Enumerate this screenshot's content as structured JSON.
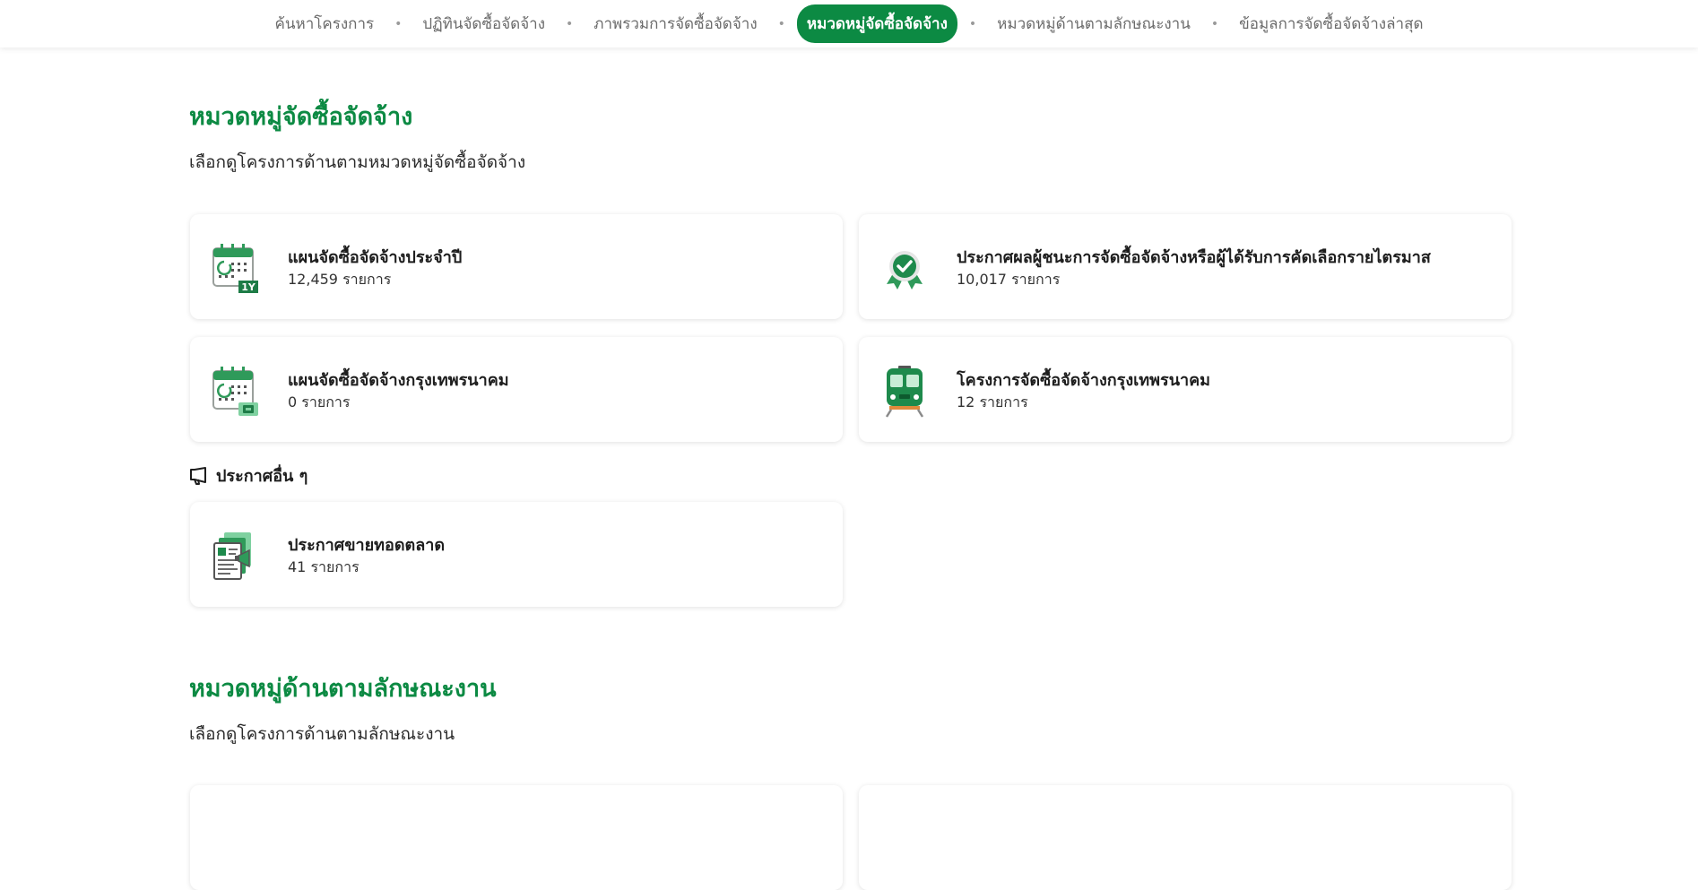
{
  "nav": {
    "items": [
      {
        "label": "ค้นหาโครงการ"
      },
      {
        "label": "ปฏิทินจัดซื้อจัดจ้าง"
      },
      {
        "label": "ภาพรวมการจัดซื้อจัดจ้าง"
      },
      {
        "label": "หมวดหมู่จัดซื้อจัดจ้าง",
        "active": true
      },
      {
        "label": "หมวดหมู่ด้านตามลักษณะงาน"
      },
      {
        "label": "ข้อมูลการจัดซื้อจัดจ้างล่าสุด"
      }
    ]
  },
  "procurement": {
    "title": "หมวดหมู่จัดซื้อจัดจ้าง",
    "description": "เลือกดูโครงการด้านตามหมวดหมู่จัดซื้อจัดจ้าง",
    "cards": [
      {
        "title": "แผนจัดซื้อจัดจ้างประจำปี",
        "count": "12,459 รายการ",
        "icon": "calendar-1y-icon",
        "badge": "1Y"
      },
      {
        "title": "ประกาศผลผู้ชนะการจัดซื้อจัดจ้างหรือผู้ได้รับการคัดเลือกรายไตรมาส",
        "count": "10,017 รายการ",
        "icon": "award-check-icon"
      },
      {
        "title": "แผนจัดซื้อจัดจ้างกรุงเทพรนาคม",
        "count": "0 รายการ",
        "icon": "calendar-bkt-icon"
      },
      {
        "title": "โครงการจัดซื้อจัดจ้างกรุงเทพรนาคม",
        "count": "12 รายการ",
        "icon": "train-icon"
      }
    ]
  },
  "other": {
    "heading": "ประกาศอื่น ๆ",
    "cards": [
      {
        "title": "ประกาศขายทอดตลาด",
        "count": "41 รายการ",
        "icon": "auction-document-icon"
      }
    ]
  },
  "work_type": {
    "title": "หมวดหมู่ด้านตามลักษณะงาน",
    "description": "เลือกดูโครงการด้านตามลักษณะงาน"
  },
  "colors": {
    "brand_green": "#0c8a43",
    "icon_green": "#2f9a5a",
    "icon_light_green": "#7fd1a0"
  }
}
